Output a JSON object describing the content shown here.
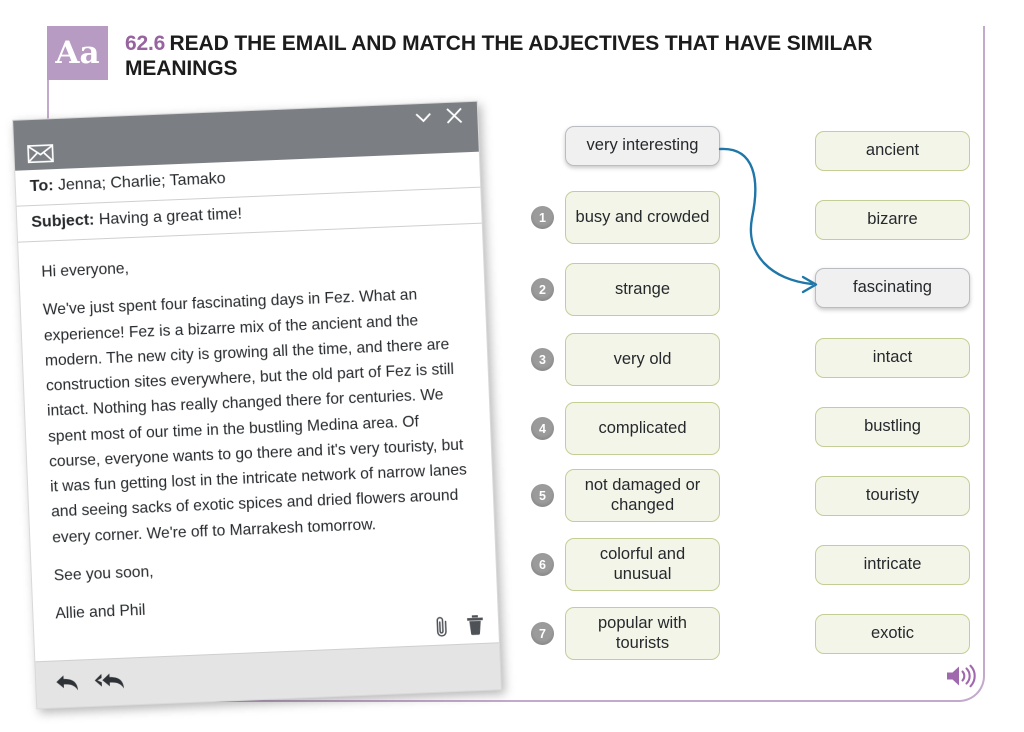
{
  "header": {
    "badge": "Aa",
    "number": "62.6",
    "title": "READ THE EMAIL AND MATCH THE ADJECTIVES THAT HAVE SIMILAR MEANINGS"
  },
  "email": {
    "envelope_icon": "envelope-icon",
    "minimize_icon": "chevron-down-icon",
    "close_icon": "close-icon",
    "to_label": "To:",
    "to_value": "Jenna; Charlie; Tamako",
    "subject_label": "Subject:",
    "subject_value": "Having a great time!",
    "body": [
      "Hi everyone,",
      "We've just spent four fascinating days in Fez. What an experience! Fez is a bizarre mix of the ancient and the modern. The new city is growing all the time, and there are construction sites everywhere, but the old part of Fez is still intact. Nothing has really changed there for centuries. We spent most of our time in the bustling Medina area. Of course, everyone wants to go there and it's very touristy, but it was fun getting lost in the intricate network of narrow lanes and seeing sacks of exotic spices and dried flowers around every corner. We're off to Marrakesh tomorrow.",
      "See you soon,",
      "Allie and Phil"
    ],
    "attach_icon": "paperclip-icon",
    "delete_icon": "trash-icon",
    "reply_icon": "reply-icon",
    "reply_all_icon": "reply-all-icon"
  },
  "exercise": {
    "definitions": [
      {
        "number": "",
        "label": "very interesting",
        "highlighted": true
      },
      {
        "number": "1",
        "label": "busy and crowded",
        "highlighted": false
      },
      {
        "number": "2",
        "label": "strange",
        "highlighted": false
      },
      {
        "number": "3",
        "label": "very old",
        "highlighted": false
      },
      {
        "number": "4",
        "label": "complicated",
        "highlighted": false
      },
      {
        "number": "5",
        "label": "not damaged or changed",
        "highlighted": false
      },
      {
        "number": "6",
        "label": "colorful and unusual",
        "highlighted": false
      },
      {
        "number": "7",
        "label": "popular with tourists",
        "highlighted": false
      }
    ],
    "adjectives": [
      {
        "label": "ancient",
        "highlighted": false
      },
      {
        "label": "bizarre",
        "highlighted": false
      },
      {
        "label": "fascinating",
        "highlighted": true
      },
      {
        "label": "intact",
        "highlighted": false
      },
      {
        "label": "bustling",
        "highlighted": false
      },
      {
        "label": "touristy",
        "highlighted": false
      },
      {
        "label": "intricate",
        "highlighted": false
      },
      {
        "label": "exotic",
        "highlighted": false
      }
    ],
    "connector": {
      "from": "very interesting",
      "to": "fascinating",
      "color": "#1f76a8"
    }
  },
  "audio": {
    "icon": "speaker-icon",
    "color": "#a069ae"
  },
  "colors": {
    "accent_purple": "#97649f",
    "badge_purple": "#b79bc2",
    "frame_purple": "#c3a9cb",
    "box_border": "#c3ce96",
    "box_fill": "#f3f5e9",
    "titlebar_gray": "#7b7f84"
  }
}
